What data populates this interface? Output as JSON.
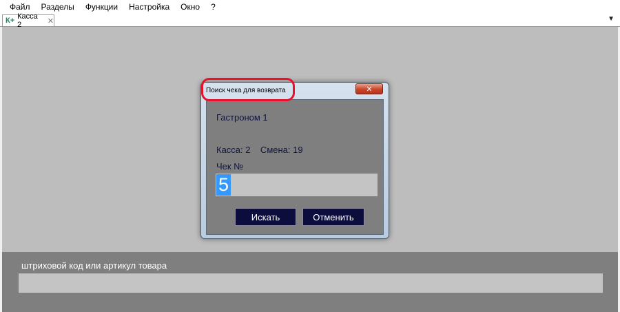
{
  "menu": {
    "items": [
      {
        "label": "Файл"
      },
      {
        "label": "Разделы"
      },
      {
        "label": "Функции"
      },
      {
        "label": "Настройка"
      },
      {
        "label": "Окно"
      },
      {
        "label": "?"
      }
    ]
  },
  "tab": {
    "logo": "К+",
    "label": "Касса 2",
    "close": "✕"
  },
  "tab_dropdown_icon": "▼",
  "dialog": {
    "title": "Поиск чека для возврата",
    "close_icon": "✕",
    "store_name": "Гастроном 1",
    "kassa_info": "Касса: 2    Смена: 19",
    "receipt_label": "Чек №",
    "receipt_value": "5",
    "search_button": "Искать",
    "cancel_button": "Отменить"
  },
  "bottom": {
    "barcode_label": "штриховой код или артикул товара",
    "barcode_value": ""
  },
  "colors": {
    "highlight": "#e8102a",
    "selection": "#3399ff",
    "button_bg": "#0d0d3d"
  }
}
